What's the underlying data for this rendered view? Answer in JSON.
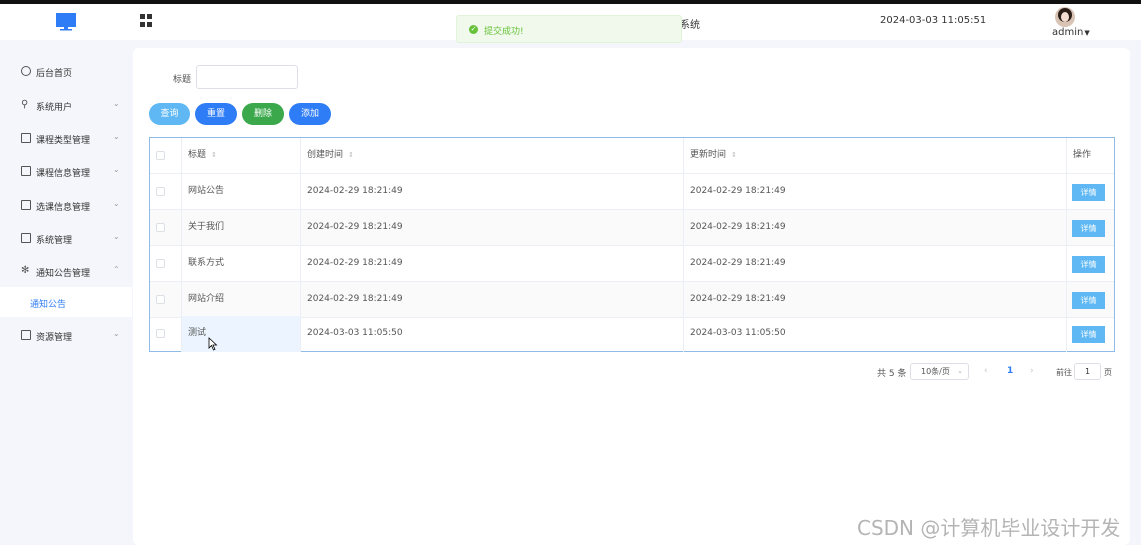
{
  "header": {
    "system_title_fragment": "系统",
    "datetime": "2024-03-03 11:05:51",
    "username": "admin",
    "icons": {
      "logo": "monitor-icon",
      "menu_toggle": "grid-icon",
      "user_caret": "caret-down-icon"
    }
  },
  "toast": {
    "text": "提交成功!",
    "type": "success",
    "icon": "check-circle-icon"
  },
  "sidebar": {
    "items": [
      {
        "label": "后台首页",
        "icon": "clock-icon",
        "expandable": false
      },
      {
        "label": "系统用户",
        "icon": "user-icon",
        "expandable": true
      },
      {
        "label": "课程类型管理",
        "icon": "card-icon",
        "expandable": true
      },
      {
        "label": "课程信息管理",
        "icon": "card-icon",
        "expandable": true
      },
      {
        "label": "选课信息管理",
        "icon": "card-icon",
        "expandable": true
      },
      {
        "label": "系统管理",
        "icon": "folder-icon",
        "expandable": true
      },
      {
        "label": "通知公告管理",
        "icon": "loading-icon",
        "expandable": true,
        "expanded": true
      },
      {
        "label": "资源管理",
        "icon": "stamp-icon",
        "expandable": true
      }
    ],
    "active_sub_item": "通知公告"
  },
  "filter": {
    "label": "标题",
    "value": "",
    "placeholder": ""
  },
  "buttons": {
    "query": "查询",
    "reset": "重置",
    "delete": "删除",
    "add": "添加"
  },
  "table": {
    "columns": [
      "标题",
      "创建时间",
      "更新时间",
      "操作"
    ],
    "rows": [
      {
        "title": "网站公告",
        "created": "2024-02-29 18:21:49",
        "updated": "2024-02-29 18:21:49",
        "action": "详情"
      },
      {
        "title": "关于我们",
        "created": "2024-02-29 18:21:49",
        "updated": "2024-02-29 18:21:49",
        "action": "详情"
      },
      {
        "title": "联系方式",
        "created": "2024-02-29 18:21:49",
        "updated": "2024-02-29 18:21:49",
        "action": "详情"
      },
      {
        "title": "网站介绍",
        "created": "2024-02-29 18:21:49",
        "updated": "2024-02-29 18:21:49",
        "action": "详情"
      },
      {
        "title": "测试",
        "created": "2024-03-03 11:05:50",
        "updated": "2024-03-03 11:05:50",
        "action": "详情"
      }
    ]
  },
  "pagination": {
    "total": "共 5 条",
    "page_size": "10条/页",
    "current_page": "1",
    "goto_label": "前往",
    "goto_value": "1",
    "goto_unit": "页"
  },
  "watermark": "CSDN @计算机毕业设计开发",
  "colors": {
    "primary": "#2f7df6",
    "info": "#5fb8f3",
    "success": "#3aa84b",
    "toast_bg": "#f0f9eb",
    "toast_text": "#67c23a"
  }
}
